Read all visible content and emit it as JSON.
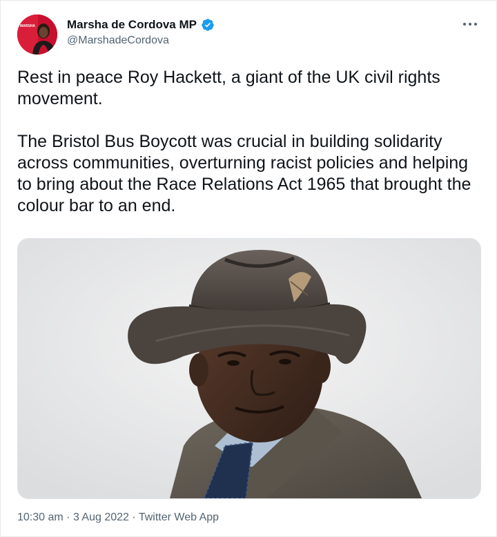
{
  "tweet": {
    "author": {
      "display_name": "Marsha de Cordova MP",
      "handle": "@MarshadeCordova",
      "verified": true,
      "avatar_badge_text": "MARSHA"
    },
    "text_paragraphs": [
      "Rest in peace Roy Hackett, a giant of the UK civil rights movement.",
      "The Bristol Bus Boycott was crucial in building solidarity across communities, overturning racist policies and helping to bring about the Race Relations Act 1965 that brought the colour bar to an end."
    ],
    "meta": {
      "time": "10:30 am",
      "separator": " · ",
      "date": "3 Aug 2022",
      "app": "Twitter Web App"
    }
  },
  "icons": {
    "more": "more-options-icon",
    "verified": "verified-badge-icon"
  },
  "colors": {
    "verified_blue": "#1d9bf0",
    "text_primary": "#0f1419",
    "text_secondary": "#536471",
    "avatar_red": "#c8102e"
  }
}
